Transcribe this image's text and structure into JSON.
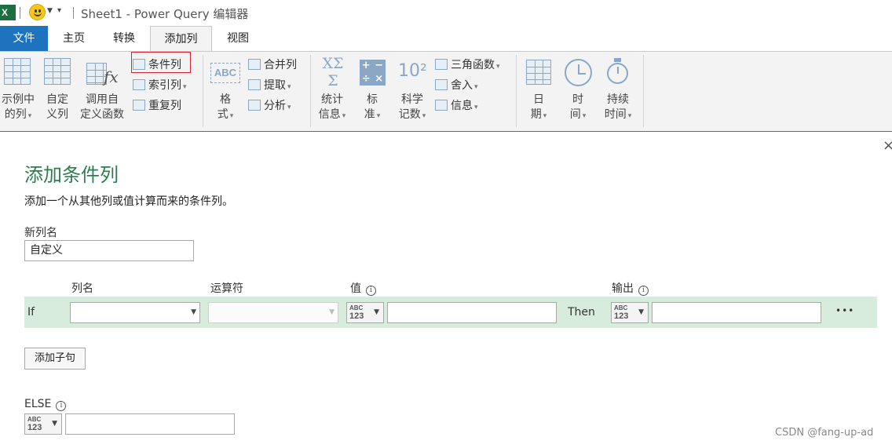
{
  "title_bar": {
    "app_badge": "X",
    "title": "Sheet1 - Power Query 编辑器"
  },
  "tabs": {
    "file": "文件",
    "home": "主页",
    "transform": "转换",
    "add_column": "添加列",
    "view": "视图"
  },
  "ribbon": {
    "col_from_examples": [
      "示例中",
      "的列"
    ],
    "custom_column": [
      "自定",
      "义列"
    ],
    "invoke_custom_function": [
      "调用自",
      "定义函数"
    ],
    "conditional_column": "条件列",
    "index_column": "索引列",
    "duplicate_column": "重复列",
    "format": [
      "格",
      "式"
    ],
    "merge_columns": "合并列",
    "extract": "提取",
    "parse": "分析",
    "statistics": [
      "统计",
      "信息"
    ],
    "standard": [
      "标",
      "准"
    ],
    "scientific": [
      "科学",
      "记数"
    ],
    "scientific_icon": "10²",
    "trigonometry": "三角函数",
    "rounding": "舍入",
    "information": "信息",
    "date": [
      "日",
      "期"
    ],
    "time": [
      "时",
      "间"
    ],
    "duration": [
      "持续",
      "时间"
    ],
    "icons": {
      "statistics": "XΣ",
      "format": "ABC"
    }
  },
  "dialog": {
    "title": "添加条件列",
    "description": "添加一个从其他列或值计算而来的条件列。",
    "new_column_name_label": "新列名",
    "new_column_name_value": "自定义",
    "headers": {
      "column_name": "列名",
      "operator": "运算符",
      "value": "值",
      "output": "输出"
    },
    "rule": {
      "if_label": "If",
      "then_label": "Then",
      "more": "•••",
      "column_value": "",
      "operator_value": "",
      "value": "",
      "output": ""
    },
    "type_icon": {
      "abc": "ABC",
      "num": "123"
    },
    "add_clause_button": "添加子句",
    "else_label": "ELSE",
    "else_value": "",
    "close": "×"
  },
  "watermark": "CSDN @fang-up-ad",
  "colors": {
    "accent": "#1e73be",
    "title_green": "#2e7d4f",
    "rule_row_bg": "#d8ecde",
    "highlight_box": "#d9232e"
  }
}
